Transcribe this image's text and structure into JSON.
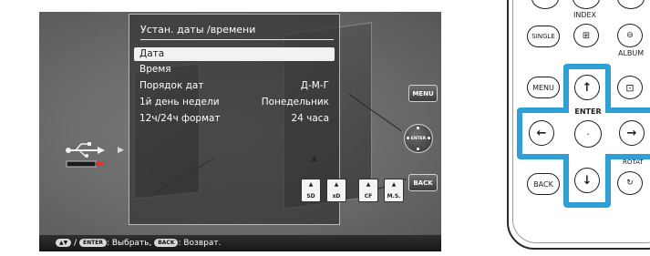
{
  "menu": {
    "title": "Устан. даты /времени",
    "items": [
      {
        "label": "Дата",
        "value": "",
        "selected": true
      },
      {
        "label": "Время",
        "value": "",
        "selected": false
      },
      {
        "label": "Порядок дат",
        "value": "Д-М-Г",
        "selected": false
      },
      {
        "label": "1й день недели",
        "value": "Понедельник",
        "selected": false
      },
      {
        "label": "12ч/24ч формат",
        "value": "24 часа",
        "selected": false
      }
    ]
  },
  "frame_buttons": {
    "menu": "MENU",
    "back": "BACK",
    "enter": "ENTER"
  },
  "card_slots": [
    "SD",
    "xD",
    "CF",
    "M.S."
  ],
  "status_bar": {
    "enter_pill": "ENTER",
    "select_text": ": Выбрать,",
    "back_pill": "BACK",
    "return_text": ": Возврат.",
    "separator": "/"
  },
  "remote": {
    "index_label": "INDEX",
    "single_label": "SINGLE",
    "album_label": "ALBUM",
    "menu_label": "MENU",
    "enter_label": "ENTER",
    "back_label": "BACK",
    "rotate_label": "ROTAT"
  },
  "colors": {
    "highlight_blue": "#2f9fd8",
    "screen_gray": "#6a6a6a",
    "status_bar": "#1e1e1e"
  }
}
